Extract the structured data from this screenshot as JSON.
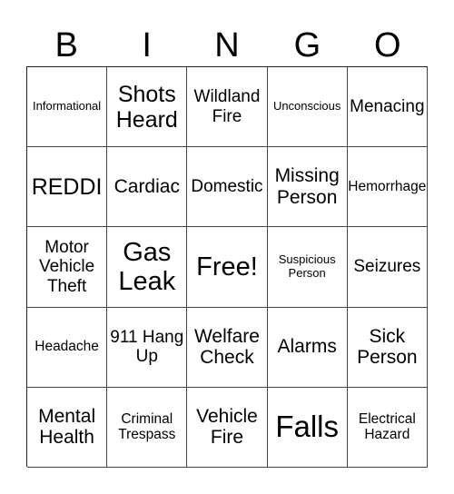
{
  "header": {
    "letters": [
      "B",
      "I",
      "N",
      "G",
      "O"
    ]
  },
  "board": {
    "cells": [
      "Informational",
      "Shots Heard",
      "Wildland Fire",
      "Unconscious",
      "Menacing",
      "REDDI",
      "Cardiac",
      "Domestic",
      "Missing Person",
      "Hemorrhage",
      "Motor Vehicle Theft",
      "Gas Leak",
      "Free!",
      "Suspicious Person",
      "Seizures",
      "Headache",
      "911 Hang Up",
      "Welfare Check",
      "Alarms",
      "Sick Person",
      "Mental Health",
      "Criminal Trespass",
      "Vehicle Fire",
      "Falls",
      "Electrical Hazard"
    ],
    "free_space": "Free!"
  }
}
